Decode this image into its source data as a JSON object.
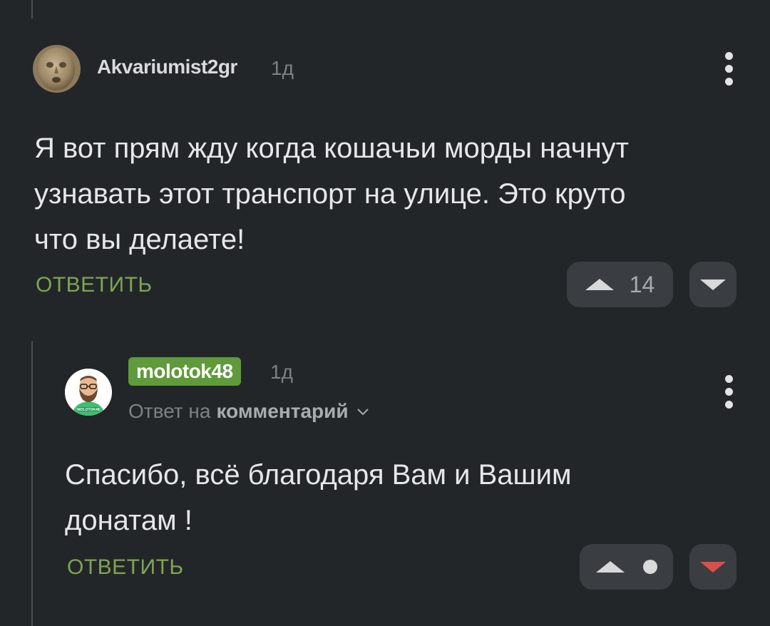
{
  "comments": [
    {
      "author": "Akvariumist2gr",
      "time": "1д",
      "text_lines": [
        "Я вот прям жду когда кошачьи морды начнут",
        "узнавать этот транспорт на улице. Это круто",
        "что вы делаете!"
      ],
      "reply_label": "ОТВЕТИТЬ",
      "score": "14",
      "menu_icon": "kebab-vertical-icon"
    },
    {
      "author": "molotok48",
      "time": "1д",
      "reply_to_prefix": "Ответ на",
      "reply_to_target": "комментарий",
      "text_lines": [
        "Спасибо, всё благодаря Вам и Вашим",
        "донатам !"
      ],
      "reply_label": "ОТВЕТИТЬ",
      "score_icon": "dot-icon",
      "avatar_shirt_text": "MOLOTOK48",
      "menu_icon": "kebab-vertical-icon"
    }
  ],
  "colors": {
    "background": "#232629",
    "accent_green": "#7ea553",
    "badge_green": "#5f9a3b",
    "downvote_red": "#d8504a"
  }
}
